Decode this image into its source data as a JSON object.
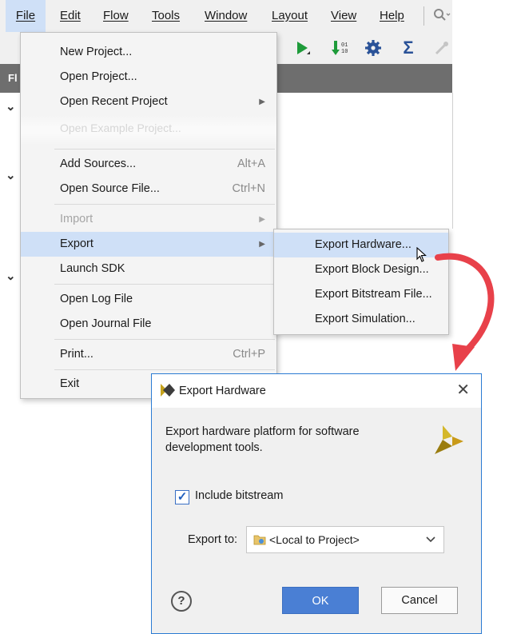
{
  "menubar": {
    "items": [
      {
        "label": "File"
      },
      {
        "label": "Edit"
      },
      {
        "label": "Flow"
      },
      {
        "label": "Tools"
      },
      {
        "label": "Window"
      },
      {
        "label": "Layout"
      },
      {
        "label": "View"
      },
      {
        "label": "Help"
      }
    ],
    "search_icon": "search-icon"
  },
  "toolbar": {
    "icons": [
      "run-icon",
      "bitstream-icon",
      "settings-gear-icon",
      "sigma-icon",
      "disabled-tool-icon"
    ]
  },
  "panel": {
    "header_label": "Fl"
  },
  "file_menu": {
    "items": [
      {
        "label": "New Project...",
        "shortcut": ""
      },
      {
        "label": "Open Project...",
        "shortcut": ""
      },
      {
        "label": "Open Recent Project",
        "shortcut": ""
      },
      {
        "label": "Open Example Project...",
        "shortcut": ""
      },
      {
        "label": "Add Sources...",
        "shortcut": "Alt+A"
      },
      {
        "label": "Open Source File...",
        "shortcut": "Ctrl+N"
      },
      {
        "label": "Import",
        "shortcut": ""
      },
      {
        "label": "Export",
        "shortcut": ""
      },
      {
        "label": "Launch SDK",
        "shortcut": ""
      },
      {
        "label": "Open Log File",
        "shortcut": ""
      },
      {
        "label": "Open Journal File",
        "shortcut": ""
      },
      {
        "label": "Print...",
        "shortcut": "Ctrl+P"
      },
      {
        "label": "Exit",
        "shortcut": ""
      }
    ]
  },
  "export_submenu": {
    "items": [
      {
        "label": "Export Hardware..."
      },
      {
        "label": "Export Block Design..."
      },
      {
        "label": "Export Bitstream File..."
      },
      {
        "label": "Export Simulation..."
      }
    ]
  },
  "dialog": {
    "title": "Export Hardware",
    "description": "Export hardware platform for software development tools.",
    "include_bitstream_label": "Include bitstream",
    "include_bitstream_checked": true,
    "export_to_label": "Export to:",
    "export_to_value": "<Local to Project>",
    "ok_label": "OK",
    "cancel_label": "Cancel",
    "help_label": "?"
  },
  "colors": {
    "accent": "#4a7fd4",
    "menu_highlight": "#cfe0f7",
    "arrow_red": "#e8414a",
    "panel_header": "#6e6e6e"
  }
}
